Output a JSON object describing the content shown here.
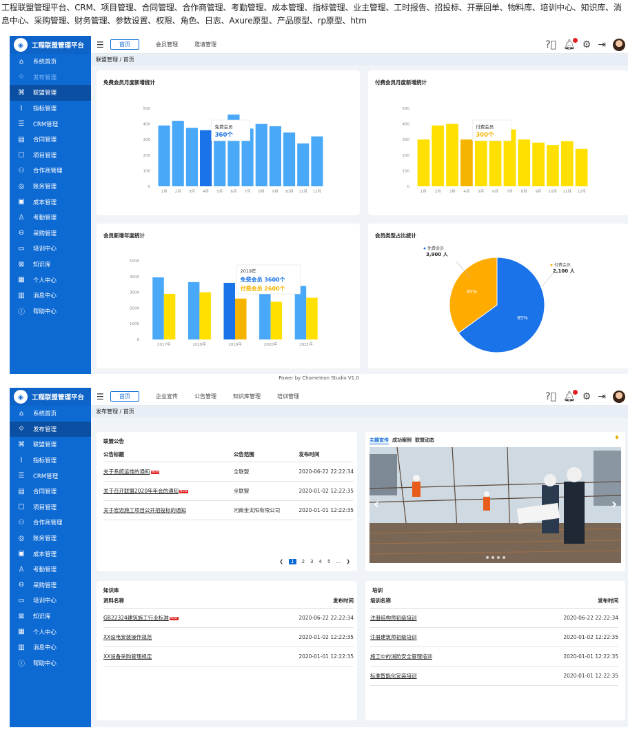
{
  "intro": "工程联盟管理平台、CRM、项目管理、合同管理、合作商管理、考勤管理、成本管理、指标管理、业主管理、工时报告、招投标、开票回单、物料库、培训中心、知识库、消息中心、采购管理、财务管理、参数设置、权限、角色、日志、Axure原型、产品原型、rp原型、htm",
  "app_title": "工程联盟管理平台",
  "sidebar_items": [
    "系统首页",
    "发布管理",
    "联盟管理",
    "指标管理",
    "CRM管理",
    "合同管理",
    "项目管理",
    "合作商管理",
    "账务管理",
    "成本管理",
    "考勤管理",
    "采购管理",
    "培训中心",
    "知识库",
    "个人中心",
    "消息中心",
    "帮助中心"
  ],
  "sidebar_icons": [
    "home-icon",
    "publish-icon",
    "alliance-icon",
    "chart-icon",
    "crm-icon",
    "contract-icon",
    "project-icon",
    "partner-icon",
    "finance-icon",
    "cost-icon",
    "attendance-icon",
    "purchase-icon",
    "training-icon",
    "knowledge-icon",
    "profile-icon",
    "message-icon",
    "help-icon"
  ],
  "footer": "Power by Chameleon Studio V1.0",
  "screen1": {
    "home_tab": "首页",
    "nav": [
      "会员管理",
      "邀请管理"
    ],
    "breadcrumb": "联盟管理 / 首页",
    "chart1_title": "免费会员月度新增统计",
    "chart2_title": "付费会员月度新增统计",
    "chart3_title": "会员新增年度统计",
    "chart4_title": "会员类型占比统计"
  },
  "screen2": {
    "home_tab": "首页",
    "nav": [
      "企业宣传",
      "公告管理",
      "知识库管理",
      "培训管理"
    ],
    "breadcrumb": "发布管理 / 首页",
    "notice": {
      "title": "联盟公告",
      "headers": [
        "公告标题",
        "公告范围",
        "发布时间"
      ],
      "rows": [
        {
          "title": "关于系统运维的通知",
          "scope": "全联盟",
          "time": "2020-06-22 22:22:34",
          "new": true
        },
        {
          "title": "关于召开联盟2020年年会的通知",
          "scope": "全联盟",
          "time": "2020-01-02 12:22:35",
          "new": true
        },
        {
          "title": "关于宏迈施工项目公开招投标的通知",
          "scope": "河南金太阳有限公司",
          "time": "2020-01-01 12:22:35",
          "new": false
        }
      ],
      "pages": [
        "1",
        "2",
        "3",
        "4",
        "5",
        "..."
      ]
    },
    "promo": {
      "tabs": [
        "主题宣传",
        "成功案例",
        "联盟动态"
      ]
    },
    "kb": {
      "title": "知识库",
      "headers": [
        "资料名称",
        "发布时间"
      ],
      "rows": [
        {
          "title": "GB22324建筑施工行业标准",
          "time": "2020-06-22 22:22:34",
          "new": true
        },
        {
          "title": "XX设电安装操作规范",
          "time": "2020-01-02 12:22:35",
          "new": false
        },
        {
          "title": "XX设备采购管理规定",
          "time": "2020-01-01 12:22:35",
          "new": false
        }
      ]
    },
    "training": {
      "title": "培训",
      "headers": [
        "培训名称",
        "发布时间"
      ],
      "rows": [
        {
          "title": "注册结构师初级培训",
          "time": "2020-06-22 22:22:34"
        },
        {
          "title": "注册建筑师初级培训",
          "time": "2020-01-02 12:22:35"
        },
        {
          "title": "施工中的消防安全管理培训",
          "time": "2020-01-01 12:22:35"
        },
        {
          "title": "标准智能化安装培训",
          "time": "2020-01-01 12:22:35"
        }
      ]
    }
  },
  "chart_data": [
    {
      "type": "bar",
      "title": "免费会员月度新增统计",
      "categories": [
        "1月",
        "2月",
        "3月",
        "4月",
        "5月",
        "6月",
        "7月",
        "8月",
        "9月",
        "10月",
        "11月",
        "12月"
      ],
      "values": [
        390,
        420,
        375,
        360,
        335,
        460,
        370,
        400,
        385,
        345,
        275,
        320
      ],
      "ylim": [
        0,
        500
      ],
      "yticks": [
        0,
        100,
        200,
        300,
        400,
        500
      ],
      "highlight_index": 3,
      "tooltip": {
        "label": "免费会员",
        "value": "360个"
      },
      "color": "#4aa8f8",
      "highlight_color": "#1a73e8"
    },
    {
      "type": "bar",
      "title": "付费会员月度新增统计",
      "categories": [
        "1月",
        "2月",
        "3月",
        "4月",
        "5月",
        "6月",
        "7月",
        "8月",
        "9月",
        "10月",
        "11月",
        "12月"
      ],
      "values": [
        300,
        390,
        400,
        300,
        330,
        335,
        365,
        300,
        280,
        265,
        290,
        240
      ],
      "ylim": [
        0,
        500
      ],
      "yticks": [
        0,
        100,
        200,
        300,
        400,
        500
      ],
      "highlight_index": 3,
      "tooltip": {
        "label": "付费会员",
        "value": "300个"
      },
      "color": "#ffe000",
      "highlight_color": "#f5b400"
    },
    {
      "type": "bar",
      "title": "会员新增年度统计",
      "categories": [
        "2017年",
        "2018年",
        "2019年",
        "2020年",
        "2021年"
      ],
      "series": [
        {
          "name": "免费会员",
          "values": [
            3950,
            3650,
            3600,
            3200,
            3400
          ]
        },
        {
          "name": "付费会员",
          "values": [
            2900,
            3000,
            2600,
            2400,
            2650
          ]
        }
      ],
      "ylim": [
        0,
        5000
      ],
      "yticks": [
        0,
        1000,
        2000,
        3000,
        4000,
        5000
      ],
      "highlight_index": 2,
      "tooltip": {
        "title": "2019年",
        "lines": [
          "免费会员 3600个",
          "付费会员 2600个"
        ]
      },
      "colors": [
        "#4aa8f8",
        "#ffe000"
      ],
      "highlight_colors": [
        "#1a73e8",
        "#f5b400"
      ]
    },
    {
      "type": "pie",
      "title": "会员类型占比统计",
      "slices": [
        {
          "name": "免费会员",
          "value": 3900,
          "value_label": "3,900 人",
          "percent": "65%",
          "color": "#1a73e8"
        },
        {
          "name": "付费会员",
          "value": 2100,
          "value_label": "2,100 人",
          "percent": "35%",
          "color": "#ffab00"
        }
      ]
    }
  ]
}
